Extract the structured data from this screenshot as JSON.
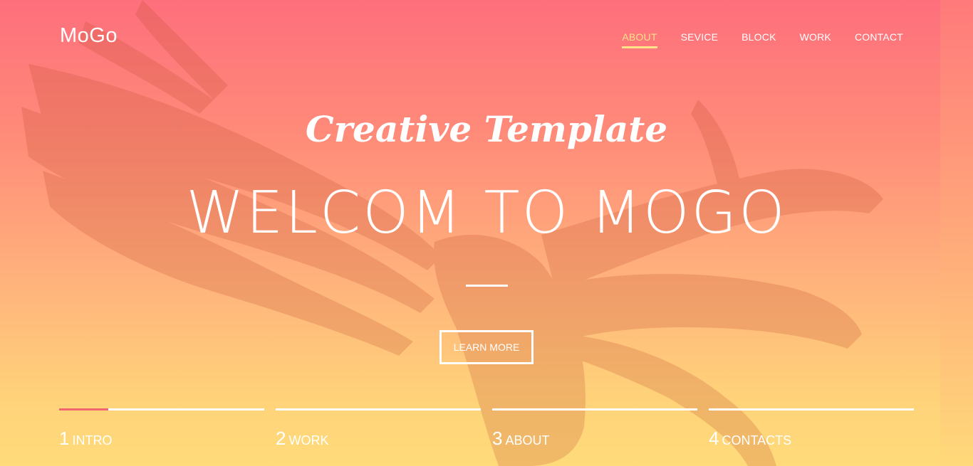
{
  "header": {
    "logo": "MoGo",
    "nav": [
      {
        "label": "ABOUT",
        "active": true
      },
      {
        "label": "SEVICE",
        "active": false
      },
      {
        "label": "BLOCK",
        "active": false
      },
      {
        "label": "WORK",
        "active": false
      },
      {
        "label": "CONTACT",
        "active": false
      }
    ]
  },
  "hero": {
    "tagline": "Creative Template",
    "headline": "WELCOM TO MOGO",
    "button_label": "LEARN MORE",
    "background_image": "eagle-illustration"
  },
  "slides": [
    {
      "num": "1",
      "label": "INTRO",
      "progress": 0.24
    },
    {
      "num": "2",
      "label": "WORK",
      "progress": 0
    },
    {
      "num": "3",
      "label": "ABOUT",
      "progress": 0
    },
    {
      "num": "4",
      "label": "CONTACTS",
      "progress": 0
    }
  ],
  "colors": {
    "accent": "#fce38a",
    "progress": "#f2666f",
    "gradient_top": "#fe6f7c",
    "gradient_bottom": "#ffdb7a"
  }
}
